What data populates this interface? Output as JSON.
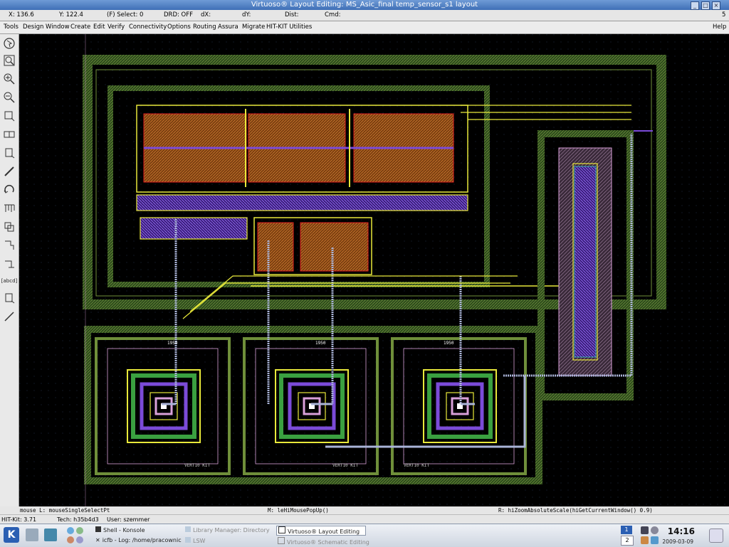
{
  "window": {
    "title": "Virtuoso® Layout Editing: MS_Asic_final temp_sensor_s1 layout"
  },
  "status": {
    "x": "X: 136.6",
    "y": "Y: 122.4",
    "select": "(F) Select: 0",
    "drd": "DRD: OFF",
    "dx": "dX:",
    "dy": "dY:",
    "dist": "Dist:",
    "cmd": "Cmd:",
    "right_num": "5"
  },
  "menu": {
    "items": [
      "Tools",
      "Design",
      "Window",
      "Create",
      "Edit",
      "Verify",
      "Connectivity",
      "Options",
      "Routing",
      "Assura",
      "Migrate",
      "HIT-KIT Utilities"
    ],
    "help": "Help"
  },
  "toolbar": {
    "icons": [
      "select-icon",
      "zoom-fit-icon",
      "zoom-in-icon",
      "zoom-out-icon",
      "rectangle-icon",
      "copy-icon",
      "stretch-icon",
      "path-icon",
      "undo-icon",
      "ruler-icon",
      "move-icon",
      "polygon-icon",
      "label-icon",
      "property-icon",
      "measure-icon"
    ],
    "label_tool_text": "[abcd]"
  },
  "canvas": {
    "labels": {
      "top1": "1950",
      "top2": "1950",
      "top3": "1950",
      "bot1": "VERT10 KIT",
      "bot2": "VERT10 KIT",
      "bot3": "VERT10 KIT"
    }
  },
  "messages": {
    "left": "mouse L: mouseSingleSelectPt",
    "mid": "M: leHiMousePopUp()",
    "right": "R: hiZoomAbsoluteScale(hiGetCurrentWindow() 0.9)"
  },
  "info": {
    "hitkit": "HIT-Kit: 3.71",
    "tech": "Tech: h35b4d3",
    "user": "User: szemmer"
  },
  "taskbar": {
    "tasks": [
      {
        "label": "Shell - Konsole",
        "state": "normal"
      },
      {
        "label": "icfb - Log: /home/pracownic",
        "state": "normal"
      },
      {
        "label": "Library Manager: Directory",
        "state": "dim"
      },
      {
        "label": "LSW",
        "state": "dim"
      },
      {
        "label": "Virtuoso® Layout Editing",
        "state": "active"
      },
      {
        "label": "Virtuoso® Schematic Editing",
        "state": "dim"
      }
    ],
    "desktop_num": "2",
    "clock": "14:16",
    "date": "2009-03-09"
  },
  "colors": {
    "canvas_bg": "#000000",
    "diffusion": "#b5651d",
    "metal_purple": "#7b4bd8",
    "metal_yellow": "#e8e83a",
    "well_green": "#3e6b2a",
    "poly_red": "#e02020",
    "outline_pink": "#d9a0d9"
  }
}
